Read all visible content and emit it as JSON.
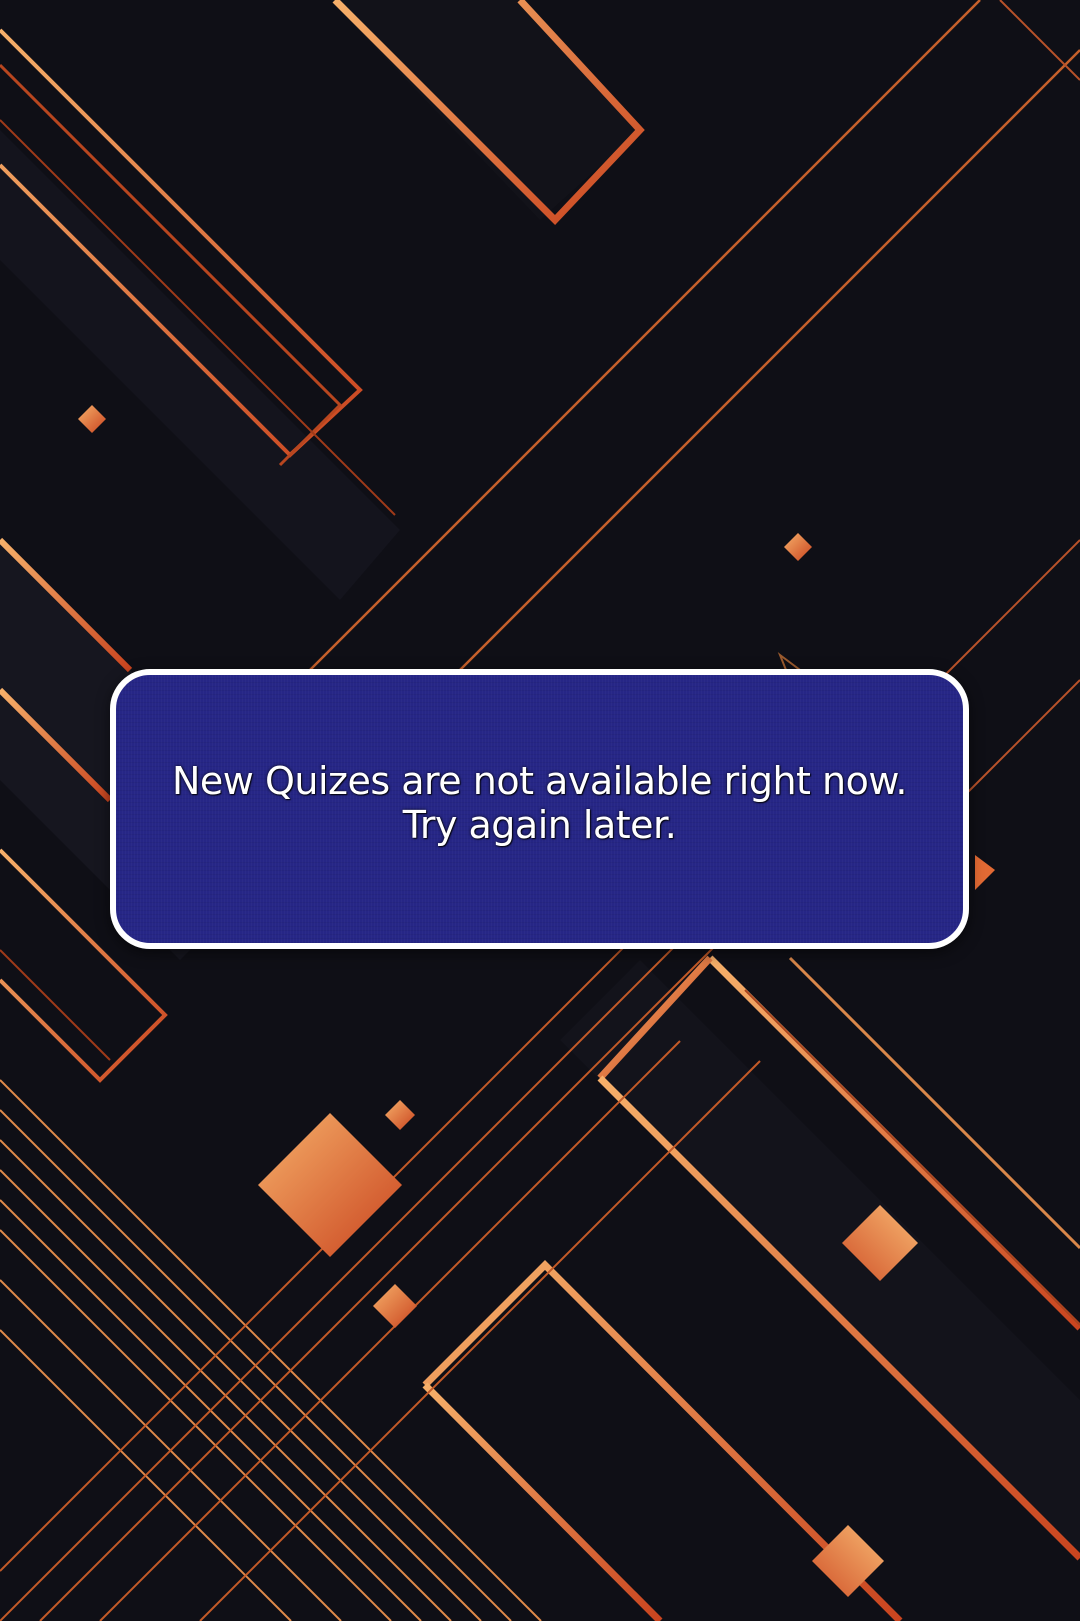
{
  "dialog": {
    "message_line1": "New Quizes are not available right now.",
    "message_line2": "Try again later."
  },
  "colors": {
    "background": "#0f0f16",
    "accent_orange": "#e8733a",
    "accent_gold": "#f3a862",
    "dialog_fill": "#262686",
    "dialog_border": "#ffffff",
    "text": "#ffffff"
  }
}
